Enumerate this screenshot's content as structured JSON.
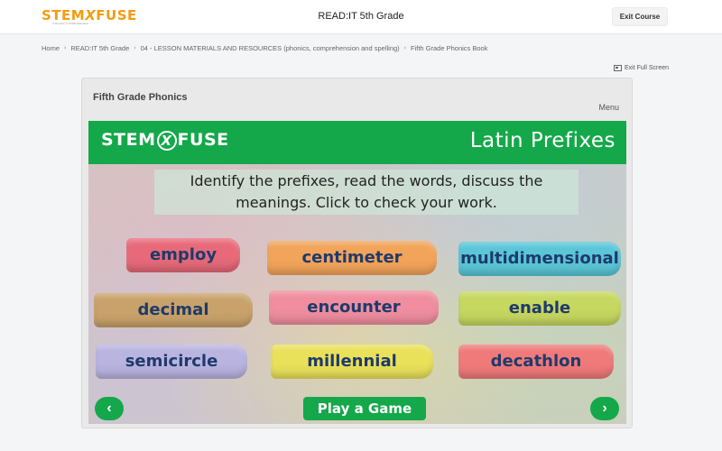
{
  "header": {
    "logo_text": "STEM",
    "logo_x": "X",
    "logo_text2": "FUSE",
    "logo_tagline": "A Member of STEM Education",
    "course_title": "READ:IT 5th Grade",
    "exit_label": "Exit Course"
  },
  "breadcrumb": [
    "Home",
    "READ:IT 5th Grade",
    "04 - LESSON MATERIALS AND RESOURCES (phonics, comprehension and spelling)",
    "Fifth Grade Phonics Book"
  ],
  "fullscreen_label": "Exit Full Screen",
  "card": {
    "title": "Fifth Grade Phonics",
    "menu_label": "Menu"
  },
  "slide": {
    "logo_text": "STEM",
    "logo_x": "X",
    "logo_text2": "FUSE",
    "title": "Latin Prefixes",
    "instructions_line1": "Identify the prefixes, read the words, discuss the",
    "instructions_line2": "meanings. Click to check your work.",
    "words": [
      "employ",
      "centimeter",
      "multidimensional",
      "decimal",
      "encounter",
      "enable",
      "semicircle",
      "millennial",
      "decathlon"
    ],
    "chalk_colors": [
      "#e86a7a",
      "#f2a45a",
      "#5ac6d8",
      "#c8a26a",
      "#f08ea0",
      "#c6d860",
      "#b9b4e0",
      "#eae15a",
      "#f07a7a"
    ],
    "play_label": "Play a Game",
    "prev_icon": "chevron-left-icon",
    "next_icon": "chevron-right-icon",
    "accent_color": "#14a84a"
  }
}
